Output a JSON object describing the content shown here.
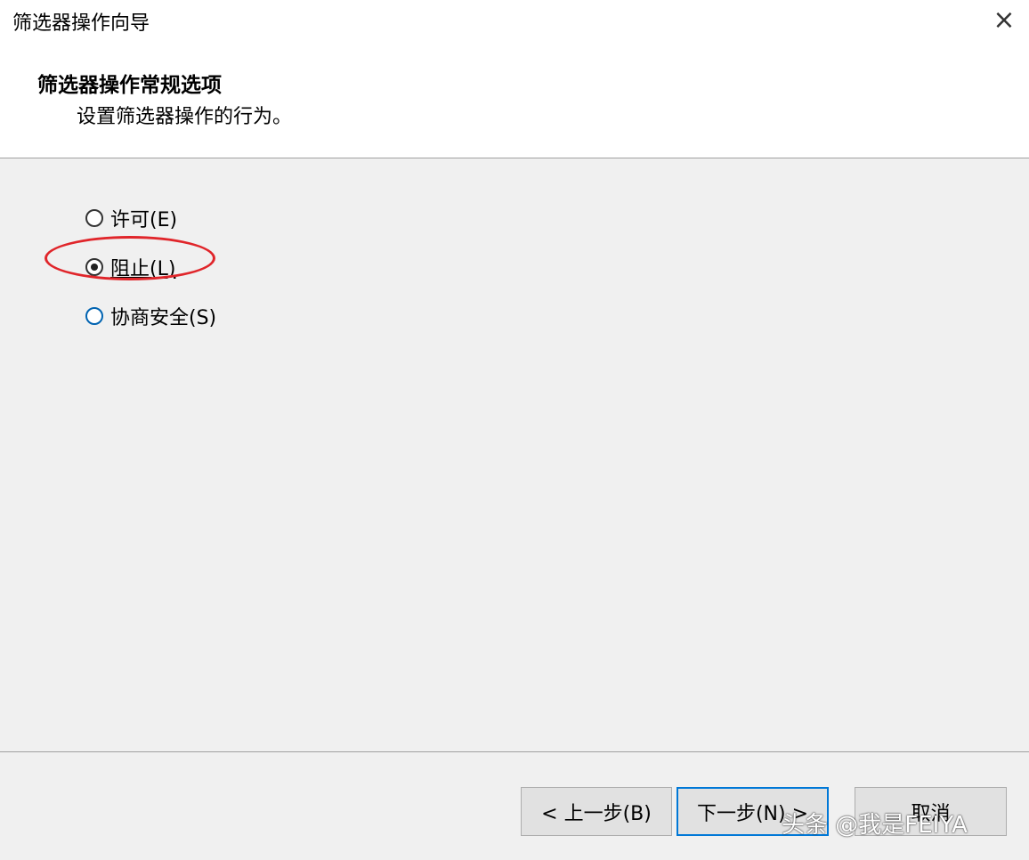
{
  "window": {
    "title": "筛选器操作向导",
    "close_icon": "×"
  },
  "header": {
    "heading": "筛选器操作常规选项",
    "subheading": "设置筛选器操作的行为。"
  },
  "options": [
    {
      "label": "许可(E)",
      "checked": false
    },
    {
      "label": "阻止(L)",
      "checked": true
    },
    {
      "label": "协商安全(S)",
      "checked": false
    }
  ],
  "buttons": {
    "back": "< 上一步(B)",
    "next": "下一步(N) >",
    "cancel": "取消"
  },
  "watermark": "头条 @我是FEIYA",
  "colors": {
    "annotation": "#e0252a",
    "accent": "#0078d7"
  }
}
